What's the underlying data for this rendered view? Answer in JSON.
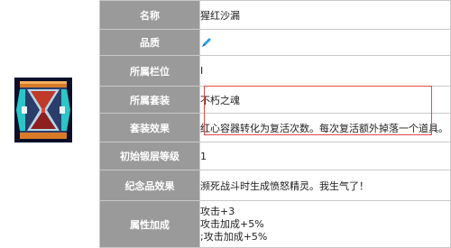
{
  "rows": [
    {
      "label": "名称",
      "value": "猩红沙漏"
    },
    {
      "label": "品质",
      "value": "",
      "value_icon": "blue-feather-quality-icon"
    },
    {
      "label": "所属栏位",
      "value": "Ⅰ"
    },
    {
      "label": "所属套装",
      "value": "不朽之魂"
    },
    {
      "label": "套装效果",
      "value": "红心容器转化为复活次数。每次复活额外掉落一个道具。"
    },
    {
      "label": "初始锻层等级",
      "value": "1"
    },
    {
      "label": "纪念品效果",
      "value": "濒死战斗时生成愤怒精灵。我生气了！"
    },
    {
      "label": "属性加成",
      "values": [
        "攻击+3",
        "攻击加成+5%",
        ";攻击加成+5%"
      ]
    }
  ],
  "item_icon": "crimson-hourglass-icon",
  "colors": {
    "label_bg": "#9a9a9a",
    "label_text": "#ffffff",
    "highlight_border": "#e24a4a",
    "quality_icon": "#2a9ee8"
  }
}
